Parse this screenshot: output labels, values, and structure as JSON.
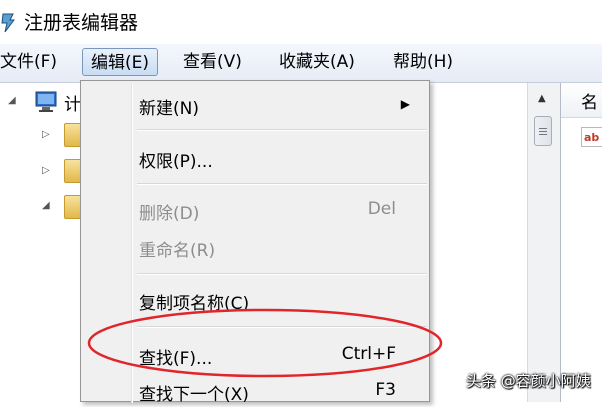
{
  "window": {
    "title": "注册表编辑器"
  },
  "menubar": {
    "items": [
      {
        "label": "文件(F)"
      },
      {
        "label": "编辑(E)"
      },
      {
        "label": "查看(V)"
      },
      {
        "label": "收藏夹(A)"
      },
      {
        "label": "帮助(H)"
      }
    ],
    "active": "编辑(E)"
  },
  "tree": {
    "root_partial": "计"
  },
  "right_pane": {
    "column_header_partial": "名"
  },
  "edit_menu": {
    "items": [
      {
        "label": "新建(N)",
        "shortcut": "",
        "submenu": true,
        "enabled": true
      },
      {
        "label": "权限(P)...",
        "shortcut": "",
        "submenu": false,
        "enabled": true
      },
      {
        "label": "删除(D)",
        "shortcut": "Del",
        "submenu": false,
        "enabled": false
      },
      {
        "label": "重命名(R)",
        "shortcut": "",
        "submenu": false,
        "enabled": false
      },
      {
        "label": "复制项名称(C)",
        "shortcut": "",
        "submenu": false,
        "enabled": true
      },
      {
        "label": "查找(F)...",
        "shortcut": "Ctrl+F",
        "submenu": false,
        "enabled": true,
        "circled": true
      },
      {
        "label": "查找下一个(X)",
        "shortcut": "F3",
        "submenu": false,
        "enabled": true
      }
    ]
  },
  "annotation": {
    "color": "#e0262b"
  },
  "watermark": "头条 @容颜小阿姨",
  "colors": {
    "menu_bg": "#f0f0f0",
    "menubar_active": "#c9dcf3",
    "disabled_text": "#8d8d8d"
  }
}
